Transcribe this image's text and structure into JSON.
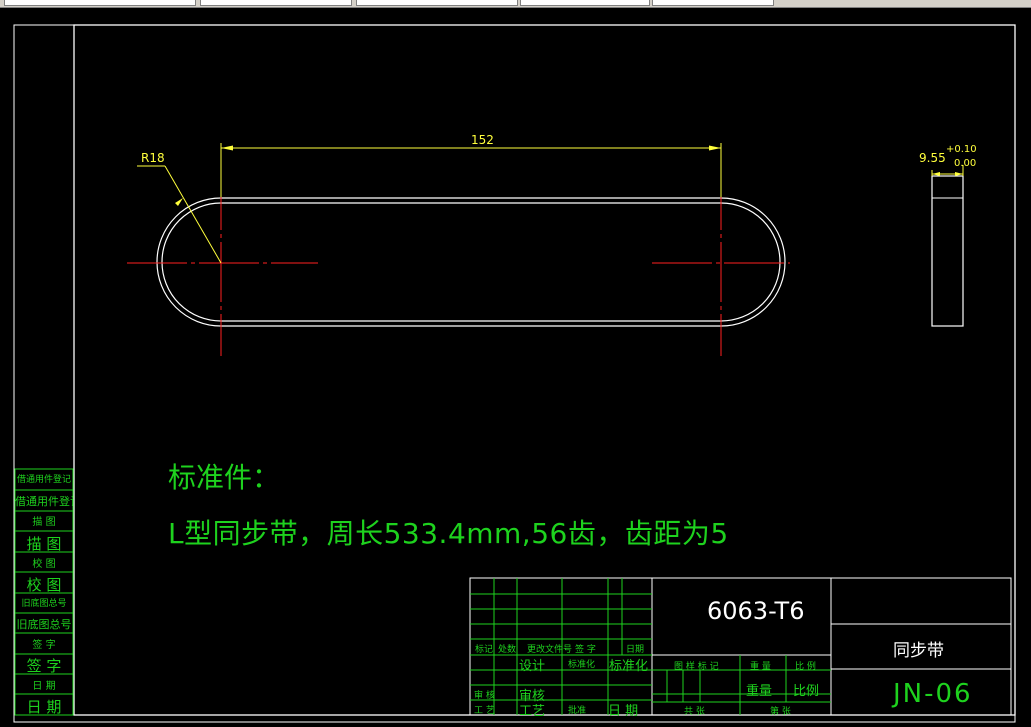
{
  "drawing": {
    "dimension_length": "152",
    "dimension_radius": "R18",
    "dimension_width": "9.55",
    "tolerance_upper": "+0.10",
    "tolerance_lower": "0.00"
  },
  "notes": {
    "title": "标准件：",
    "body": "L型同步带，周长533.4mm,56齿，齿距为5"
  },
  "title_block": {
    "material": "6063-T6",
    "part_name": "同步带",
    "drawing_number": "JN-06",
    "row_labels_small": [
      "标记",
      "处数",
      "更改文件号",
      "签 字",
      "日期"
    ],
    "design": "设计",
    "standardize_small": "标准化",
    "standardize": "标准化",
    "review": "审核",
    "process": "工艺",
    "date": "日 期",
    "stage_mark": "图 样 标 记",
    "weight": "重 量",
    "ratio": "比 例",
    "weight_big": "重量",
    "ratio_big": "比例",
    "sheets_total": "共 张",
    "sheet_no": "第 张",
    "audit_small": "审 核",
    "craft_small": "工 艺",
    "approve_small": "批准"
  },
  "side_panel": {
    "items": [
      "借通用件登记",
      "借通用件登记",
      "描  图",
      "描 图",
      "校  图",
      "校 图",
      "旧底图总号",
      "旧底图总号",
      "签  字",
      "签 字",
      "日  期",
      "日 期"
    ]
  }
}
